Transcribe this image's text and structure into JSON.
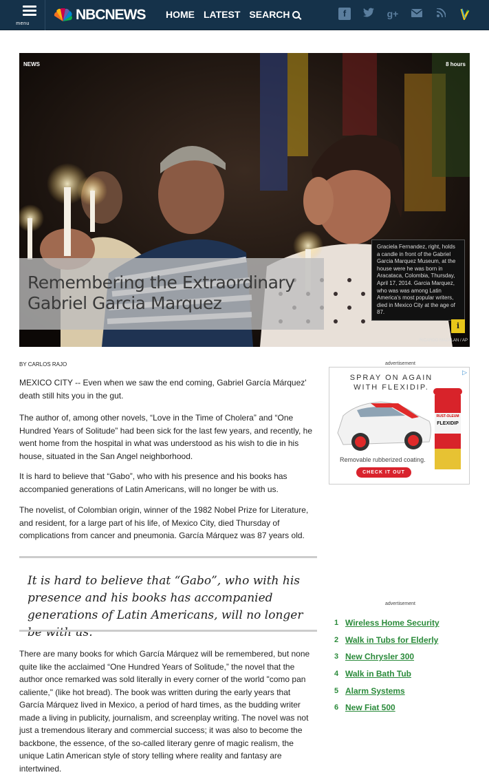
{
  "header": {
    "menu_label": "menu",
    "logo_text": "NBCNEWS",
    "nav": [
      "HOME",
      "LATEST",
      "SEARCH"
    ],
    "social_icons": [
      "facebook-icon",
      "twitter-icon",
      "google-plus-icon",
      "email-icon",
      "rss-icon",
      "vine-icon"
    ],
    "bar_color": "#15324a"
  },
  "hero": {
    "section": "NEWS",
    "time": "8 hours",
    "title_line1": "Remembering the Extraordinary",
    "title_line2": "Gabriel Garcia Marquez",
    "caption": "Graciela Fernandez, right, holds a candle in front of the Gabriel Garcia Marquez Museum, at the house were he was born in Aracataca, Colombia, Thursday, April 17, 2014. Garcia Marquez, who was was among Latin America's most popular writers, died in Mexico City at the age of 87.",
    "info": "i",
    "credit": "RICARDO MAZALAN / AP"
  },
  "article": {
    "byline": "BY CARLOS RAJO",
    "paragraphs": [
      "MEXICO CITY -- Even when we saw the end coming, Gabriel García Márquez' death still hits you in the gut.",
      "The author of, among other novels, “Love in the Time of Cholera” and “One Hundred Years of Solitude” had been sick for the last few years, and recently, he went home from the hospital in what was understood as his wish to die in his house, situated in the San Angel neighborhood.",
      "It is hard to believe that “Gabo”, who with his presence and his books has accompanied generations of Latin Americans, will no longer be with us.",
      "The novelist, of Colombian origin, winner of the 1982 Nobel Prize for Literature, and resident, for a large part of his life, of Mexico City, died Thursday of complications from cancer and pneumonia. García Márquez was 87 years old.",
      "There are many books for which García Márquez will be remembered, but none quite like the acclaimed “One Hundred Years of Solitude,” the novel that the author once remarked was sold literally in every corner of the world \"como pan caliente,\" (like hot bread). The book was written during the early years that García Márquez lived in Mexico, a period of hard times, as the budding writer made a living in publicity, journalism, and screenplay writing. The novel was not just a tremendous literary and commercial success; it was also to become the backbone, the essence, of the so-called literary genre of magic realism, the unique Latin American style of story telling where reality and fantasy are intertwined."
    ],
    "pullquote": "It is hard to believe that “Gabo”, who with his presence and his books has accompanied generations of Latin Americans, will no longer be with us."
  },
  "sidebar": {
    "ad_label": "advertisement",
    "ad": {
      "headline_line1": "SPRAY ON AGAIN",
      "headline_line2": "WITH FLEXIDIP.",
      "subtext": "Removable rubberized coating.",
      "cta": "CHECK IT OUT",
      "can_brand": "RUST-OLEUM",
      "can_product": "FLEXIDIP"
    },
    "ad_label2": "advertisement",
    "links": [
      {
        "num": "1",
        "text": "Wireless Home Security"
      },
      {
        "num": "2",
        "text": "Walk in Tubs for Elderly"
      },
      {
        "num": "3",
        "text": "New Chrysler 300"
      },
      {
        "num": "4",
        "text": "Walk in Bath Tub"
      },
      {
        "num": "5",
        "text": "Alarm Systems"
      },
      {
        "num": "6",
        "text": "New Fiat 500"
      }
    ],
    "link_color": "#2a8a3a"
  }
}
